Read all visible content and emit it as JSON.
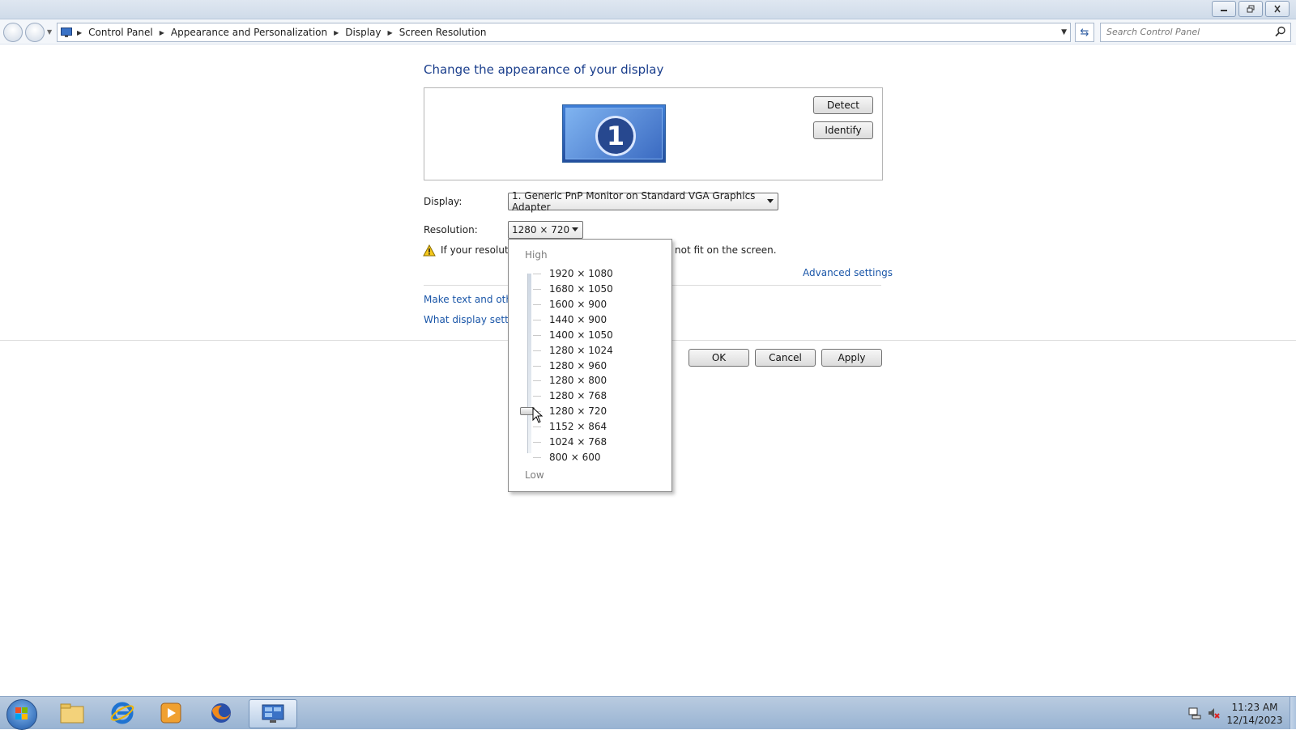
{
  "address": {
    "breadcrumbs": [
      "Control Panel",
      "Appearance and Personalization",
      "Display",
      "Screen Resolution"
    ],
    "search_placeholder": "Search Control Panel"
  },
  "main": {
    "heading": "Change the appearance of your display",
    "monitor_number": "1",
    "detect_label": "Detect",
    "identify_label": "Identify",
    "display_label": "Display:",
    "display_value": "1. Generic PnP Monitor on Standard VGA Graphics Adapter",
    "resolution_label": "Resolution:",
    "resolution_value": "1280 × 720",
    "warning_left": "If your resolutio",
    "warning_right": "not fit on the screen.",
    "advanced_link": "Advanced settings",
    "link1": "Make text and other",
    "link2": "What display setting",
    "ok_label": "OK",
    "cancel_label": "Cancel",
    "apply_label": "Apply"
  },
  "dropdown": {
    "high_label": "High",
    "low_label": "Low",
    "options": [
      "1920 × 1080",
      "1680 × 1050",
      "1600 × 900",
      "1440 × 900",
      "1400 × 1050",
      "1280 × 1024",
      "1280 × 960",
      "1280 × 800",
      "1280 × 768",
      "1280 × 720",
      "1152 × 864",
      "1024 × 768",
      "800 × 600"
    ],
    "selected": "1280 × 720"
  },
  "taskbar": {
    "time": "11:23 AM",
    "date": "12/14/2023"
  },
  "colors": {
    "link": "#1a56a8",
    "heading": "#1a3e8c",
    "taskbar": "#98b3d2"
  }
}
